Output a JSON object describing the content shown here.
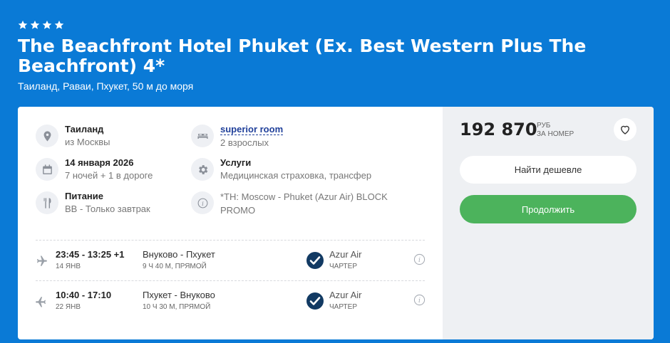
{
  "hotel": {
    "stars": 4,
    "title": "The Beachfront Hotel Phuket (Ex. Best Western Plus The Beachfront) 4*",
    "location": "Таиланд, Раваи, Пхукет, 50 м до моря"
  },
  "details": {
    "destination": {
      "title": "Таиланд",
      "sub": "из Москвы",
      "icon": "location-pin-icon"
    },
    "room": {
      "title": "superior room",
      "sub": "2 взрослых",
      "icon": "bed-icon"
    },
    "dates": {
      "title": "14 января 2026",
      "sub": "7 ночей + 1 в дороге",
      "icon": "calendar-icon"
    },
    "services": {
      "title": "Услуги",
      "sub": "Медицинская страховка, трансфер",
      "icon": "gear-icon"
    },
    "meals": {
      "title": "Питание",
      "sub": "BB - Только завтрак",
      "icon": "fork-knife-icon"
    },
    "note": {
      "line1": "*TH: Moscow - Phuket (Azur Air) BLOCK",
      "line2": "PROMO",
      "icon": "info-icon"
    }
  },
  "flights": [
    {
      "time": "23:45 - 13:25 +1",
      "date": "14 ЯНВ",
      "route": "Внуково - Пхукет",
      "duration": "9 Ч 40 М, ПРЯМОЙ",
      "airline": "Azur Air",
      "type": "ЧАРТЕР"
    },
    {
      "time": "10:40 - 17:10",
      "date": "22 ЯНВ",
      "route": "Пхукет - Внуково",
      "duration": "10 Ч 30 М, ПРЯМОЙ",
      "airline": "Azur Air",
      "type": "ЧАРТЕР"
    }
  ],
  "pricing": {
    "price": "192 870",
    "currency": "РУБ",
    "per": "ЗА НОМЕР",
    "cheaper_label": "Найти дешевле",
    "continue_label": "Продолжить"
  },
  "colors": {
    "background": "#0a7ad6",
    "accent_green": "#4cb35c",
    "link": "#1f3f9a"
  }
}
